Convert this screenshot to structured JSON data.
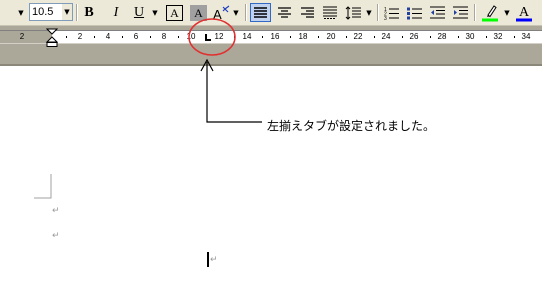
{
  "toolbar": {
    "font_size": "10.5",
    "bold_label": "B",
    "italic_label": "I",
    "underline_label": "U",
    "border_char_label": "A",
    "shade_char_label": "A",
    "phonetic_label": "亜",
    "font_color_label": "A",
    "highlight_color": "#00ff00",
    "font_color": "#0000ff",
    "icons": [
      "dropdown-arrow",
      "bold-icon",
      "italic-icon",
      "underline-icon",
      "char-border-icon",
      "char-shading-icon",
      "phonetic-guide-icon",
      "justify-icon",
      "center-icon",
      "align-right-icon",
      "distributed-icon",
      "line-spacing-icon",
      "numbering-icon",
      "bullets-icon",
      "decrease-indent-icon",
      "increase-indent-icon",
      "highlight-icon",
      "font-color-icon"
    ]
  },
  "ruler": {
    "numbers": [
      "2",
      "2",
      "4",
      "6",
      "8",
      "10",
      "12",
      "14",
      "16",
      "18",
      "20",
      "22",
      "24",
      "26",
      "28",
      "30",
      "32",
      "34"
    ],
    "tab_marker": "L"
  },
  "annotation": {
    "text": "左揃えタブが設定されました。",
    "circle_color": "#e03030"
  },
  "document": {
    "paragraph_mark": "↵"
  }
}
